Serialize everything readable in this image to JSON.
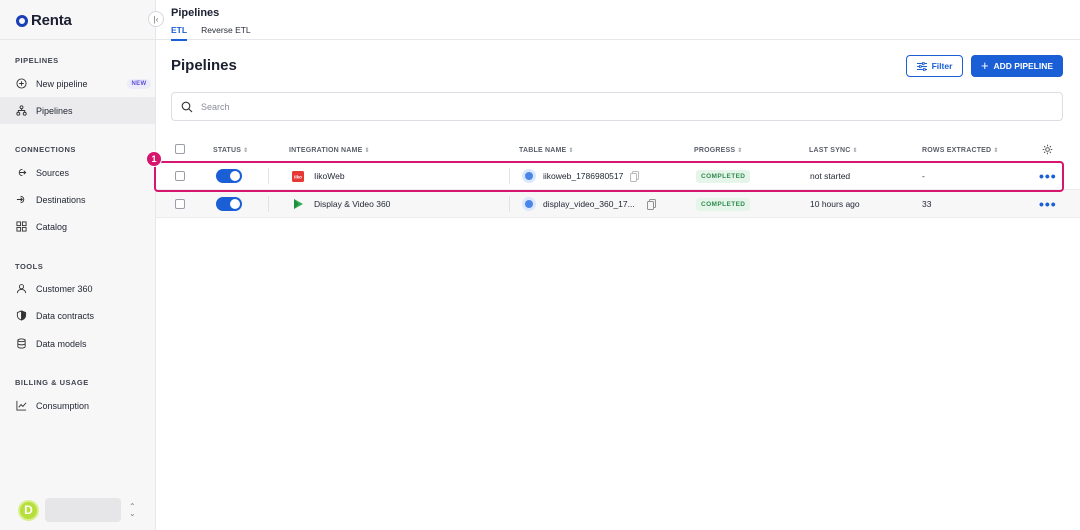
{
  "app": {
    "logo_text": "Renta"
  },
  "sidebar": {
    "sections": [
      {
        "title": "PIPELINES"
      },
      {
        "title": "CONNECTIONS"
      },
      {
        "title": "TOOLS"
      },
      {
        "title": "BILLING & USAGE"
      }
    ],
    "items": [
      {
        "label": "New pipeline",
        "icon": "plus-circle-icon",
        "badge": "NEW"
      },
      {
        "label": "Pipelines",
        "icon": "pipelines-icon",
        "active": true
      },
      {
        "label": "Sources",
        "icon": "source-icon"
      },
      {
        "label": "Destinations",
        "icon": "destination-icon"
      },
      {
        "label": "Catalog",
        "icon": "grid-icon"
      },
      {
        "label": "Customer 360",
        "icon": "user-icon"
      },
      {
        "label": "Data contracts",
        "icon": "shield-icon"
      },
      {
        "label": "Data models",
        "icon": "database-icon"
      },
      {
        "label": "Consumption",
        "icon": "chart-line-icon"
      }
    ],
    "user": {
      "initial": "D"
    }
  },
  "header": {
    "title": "Pipelines",
    "tabs": [
      {
        "label": "ETL",
        "active": true
      },
      {
        "label": "Reverse ETL"
      }
    ]
  },
  "main": {
    "title": "Pipelines",
    "filter_label": "Filter",
    "add_label": "ADD PIPELINE",
    "search_placeholder": "Search",
    "annotation_number": "1"
  },
  "table": {
    "columns": [
      "STATUS",
      "INTEGRATION NAME",
      "TABLE NAME",
      "PROGRESS",
      "LAST SYNC",
      "ROWS EXTRACTED"
    ],
    "rows": [
      {
        "enabled": true,
        "integration": "IikoWeb",
        "integration_icon": "iikoweb-icon",
        "table_name": "iikoweb_1786980517",
        "progress": "COMPLETED",
        "last_sync": "not started",
        "rows_extracted": "-"
      },
      {
        "enabled": true,
        "integration": "Display & Video 360",
        "integration_icon": "dv360-icon",
        "table_name": "display_video_360_17...",
        "progress": "COMPLETED",
        "last_sync": "10 hours ago",
        "rows_extracted": "33"
      }
    ]
  },
  "colors": {
    "accent": "#1a5fd6",
    "highlight": "#d6156c",
    "completed": "#2e8b4c"
  }
}
